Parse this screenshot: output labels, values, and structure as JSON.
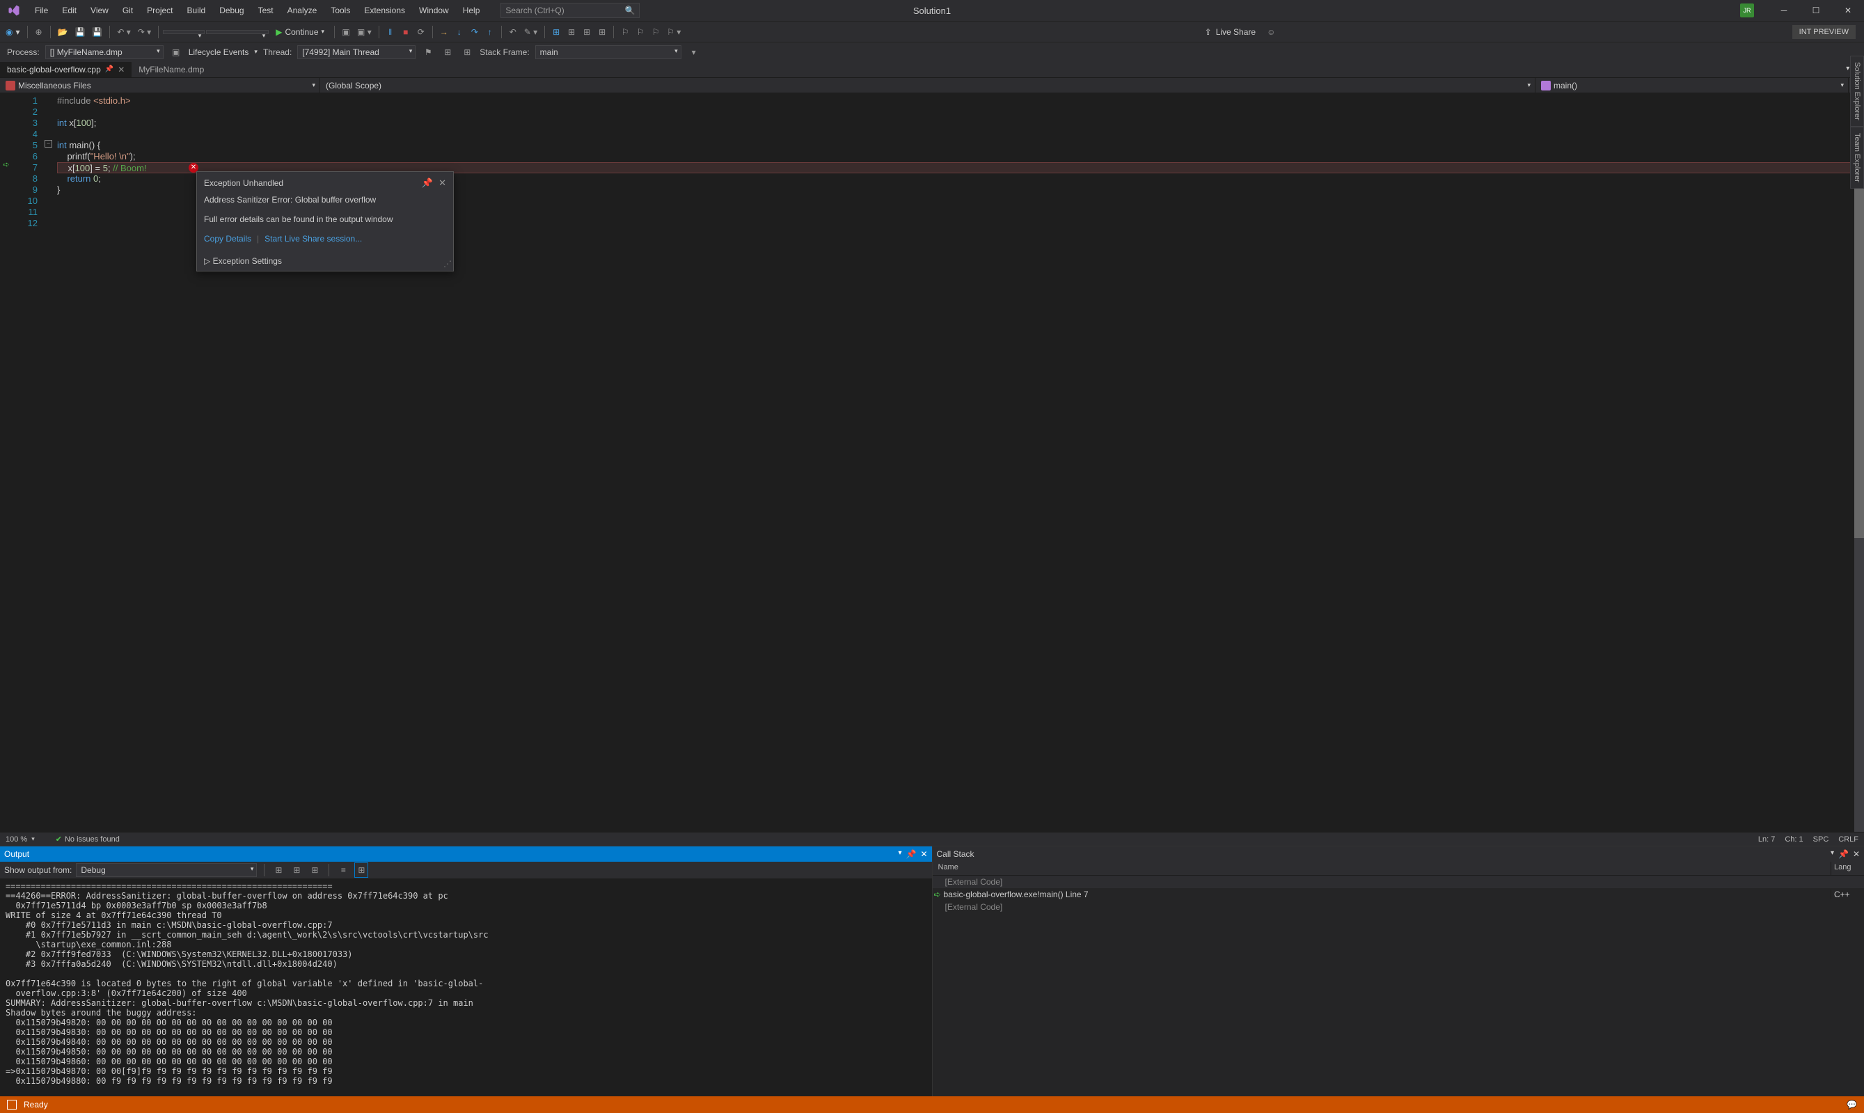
{
  "solution_name": "Solution1",
  "user_initials": "JR",
  "int_preview": "INT PREVIEW",
  "menu": [
    "File",
    "Edit",
    "View",
    "Git",
    "Project",
    "Build",
    "Debug",
    "Test",
    "Analyze",
    "Tools",
    "Extensions",
    "Window",
    "Help"
  ],
  "search_placeholder": "Search (Ctrl+Q)",
  "continue_label": "Continue",
  "live_share_label": "Live Share",
  "debugbar": {
    "process_label": "Process:",
    "process_value": "[] MyFileName.dmp",
    "lifecycle_label": "Lifecycle Events",
    "thread_label": "Thread:",
    "thread_value": "[74992] Main Thread",
    "stackframe_label": "Stack Frame:",
    "stackframe_value": "main"
  },
  "tabs": [
    {
      "name": "basic-global-overflow.cpp",
      "active": true
    },
    {
      "name": "MyFileName.dmp",
      "active": false
    }
  ],
  "nav": {
    "scope1": "Miscellaneous Files",
    "scope2": "(Global Scope)",
    "scope3": "main()"
  },
  "code": {
    "lines": [
      "#include <stdio.h>",
      "",
      "int x[100];",
      "",
      "int main() {",
      "    printf(\"Hello! \\n\");",
      "    x[100] = 5; // Boom!",
      "    return 0;",
      "}",
      "",
      "",
      ""
    ],
    "highlight_line": 7
  },
  "exception": {
    "title": "Exception Unhandled",
    "message": "Address Sanitizer Error: Global buffer overflow",
    "detail": "Full error details can be found in the output window",
    "copy": "Copy Details",
    "liveshare": "Start Live Share session...",
    "settings": "Exception Settings"
  },
  "editor_status": {
    "zoom": "100 %",
    "issues": "No issues found",
    "ln": "Ln: 7",
    "ch": "Ch: 1",
    "spc": "SPC",
    "crlf": "CRLF"
  },
  "output": {
    "title": "Output",
    "show_label": "Show output from:",
    "show_value": "Debug",
    "text": "=================================================================\n==44260==ERROR: AddressSanitizer: global-buffer-overflow on address 0x7ff71e64c390 at pc\n  0x7ff71e5711d4 bp 0x0003e3aff7b0 sp 0x0003e3aff7b8\nWRITE of size 4 at 0x7ff71e64c390 thread T0\n    #0 0x7ff71e5711d3 in main c:\\MSDN\\basic-global-overflow.cpp:7\n    #1 0x7ff71e5b7927 in __scrt_common_main_seh d:\\agent\\_work\\2\\s\\src\\vctools\\crt\\vcstartup\\src\n      \\startup\\exe_common.inl:288\n    #2 0x7fff9fed7033  (C:\\WINDOWS\\System32\\KERNEL32.DLL+0x180017033)\n    #3 0x7fffa0a5d240  (C:\\WINDOWS\\SYSTEM32\\ntdll.dll+0x18004d240)\n\n0x7ff71e64c390 is located 0 bytes to the right of global variable 'x' defined in 'basic-global-\n  overflow.cpp:3:8' (0x7ff71e64c200) of size 400\nSUMMARY: AddressSanitizer: global-buffer-overflow c:\\MSDN\\basic-global-overflow.cpp:7 in main\nShadow bytes around the buggy address:\n  0x115079b49820: 00 00 00 00 00 00 00 00 00 00 00 00 00 00 00 00\n  0x115079b49830: 00 00 00 00 00 00 00 00 00 00 00 00 00 00 00 00\n  0x115079b49840: 00 00 00 00 00 00 00 00 00 00 00 00 00 00 00 00\n  0x115079b49850: 00 00 00 00 00 00 00 00 00 00 00 00 00 00 00 00\n  0x115079b49860: 00 00 00 00 00 00 00 00 00 00 00 00 00 00 00 00\n=>0x115079b49870: 00 00[f9]f9 f9 f9 f9 f9 f9 f9 f9 f9 f9 f9 f9 f9\n  0x115079b49880: 00 f9 f9 f9 f9 f9 f9 f9 f9 f9 f9 f9 f9 f9 f9 f9"
  },
  "callstack": {
    "title": "Call Stack",
    "col_name": "Name",
    "col_lang": "Lang",
    "rows": [
      {
        "name": "[External Code]",
        "lang": "",
        "type": "ext"
      },
      {
        "name": "basic-global-overflow.exe!main() Line 7",
        "lang": "C++",
        "type": "active"
      },
      {
        "name": "[External Code]",
        "lang": "",
        "type": "ext"
      }
    ]
  },
  "statusbar": {
    "ready": "Ready"
  },
  "side_tabs": [
    "Solution Explorer",
    "Team Explorer"
  ]
}
